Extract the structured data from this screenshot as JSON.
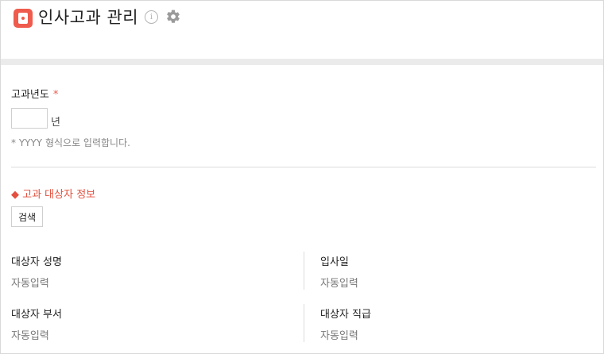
{
  "header": {
    "title": "인사고과 관리",
    "icon": "person-card-icon",
    "accent_color": "#ef5b4d"
  },
  "year_field": {
    "label": "고과년도",
    "required_mark": "*",
    "value": "",
    "unit": "년",
    "hint": "* YYYY 형식으로 입력합니다."
  },
  "target_section": {
    "title": "◆ 고과 대상자 정보",
    "title_color": "#e2503f",
    "search_button": "검색",
    "fields": [
      {
        "label": "대상자 성명",
        "value": "자동입력"
      },
      {
        "label": "입사일",
        "value": "자동입력"
      },
      {
        "label": "대상자 부서",
        "value": "자동입력"
      },
      {
        "label": "대상자 직급",
        "value": "자동입력"
      }
    ]
  }
}
